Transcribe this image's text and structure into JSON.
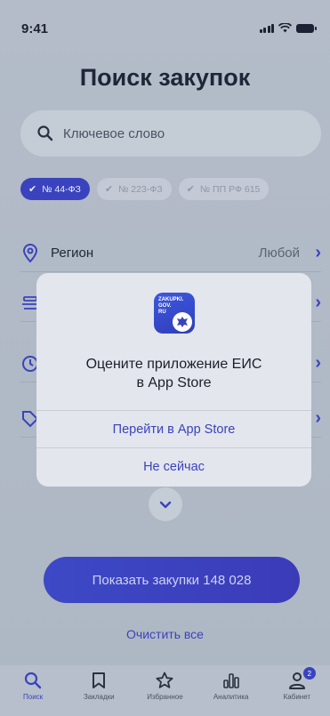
{
  "status": {
    "time": "9:41"
  },
  "page": {
    "title": "Поиск закупок"
  },
  "search": {
    "placeholder": "Ключевое слово"
  },
  "chips": [
    {
      "label": "№ 44-ФЗ",
      "active": true
    },
    {
      "label": "№ 223-ФЗ",
      "active": false
    },
    {
      "label": "№ ПП РФ 615",
      "active": false
    }
  ],
  "filters": [
    {
      "label": "Регион",
      "value": "Любой",
      "icon": "location-pin-icon"
    }
  ],
  "primary_button": {
    "label": "Показать закупки 148 028"
  },
  "clear_link": {
    "label": "Очистить все"
  },
  "tabs": [
    {
      "label": "Поиск",
      "icon": "search-icon",
      "active": true
    },
    {
      "label": "Закладки",
      "icon": "bookmark-icon",
      "active": false
    },
    {
      "label": "Избранное",
      "icon": "star-icon",
      "active": false
    },
    {
      "label": "Аналитика",
      "icon": "bar-chart-icon",
      "active": false
    },
    {
      "label": "Кабинет",
      "icon": "user-icon",
      "active": false,
      "badge": "2"
    }
  ],
  "alert": {
    "app_icon_text": "ZAKUPKI.\nGOV.\nRU",
    "title_line1": "Оцените приложение ЕИС",
    "title_line2": "в App Store",
    "primary_action": "Перейти в App Store",
    "secondary_action": "Не сейчас"
  },
  "colors": {
    "accent": "#3a43bd",
    "dim_overlay": "#b0b9c6",
    "alert_bg": "#e3e6ec"
  }
}
